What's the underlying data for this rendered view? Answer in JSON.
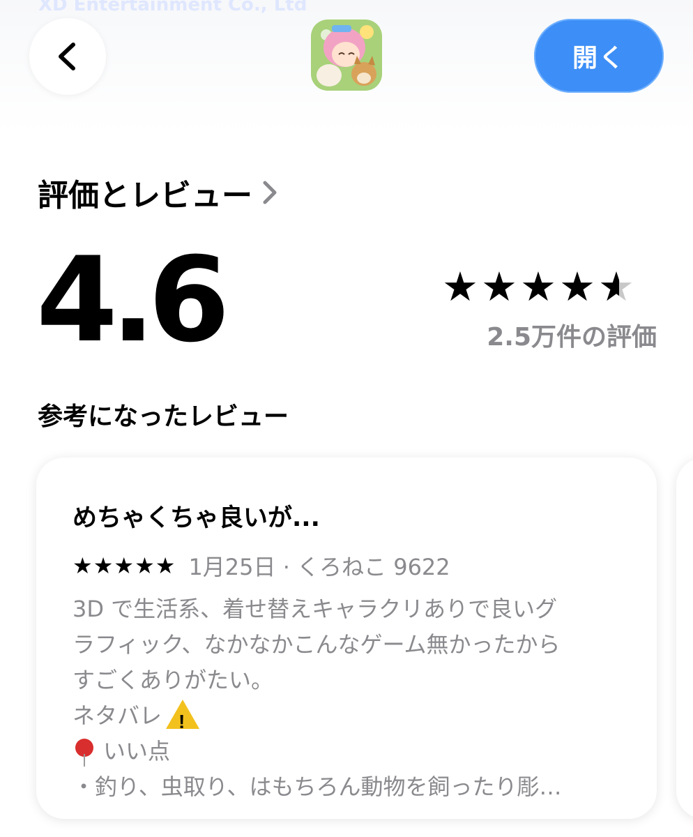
{
  "header": {
    "developer_faded": "XD Entertainment Co., Ltd",
    "open_label": "開く"
  },
  "ratings": {
    "section_title": "評価とレビュー",
    "score": "4.6",
    "stars_value": 4.6,
    "stars_max": 5,
    "count_label": "2.5万件の評価",
    "helpful_title": "参考になったレビュー"
  },
  "review": {
    "title": "めちゃくちゃ良いが...",
    "stars": "★★★★★",
    "meta": "1月25日 · くろねこ 9622",
    "lines": [
      "3D で生活系、着せ替えキャラクリありで良いグ",
      "ラフィック、なかなかこんなゲーム無かったから",
      "すごくありがたい。",
      "ネタバレ",
      "いい点",
      "・釣り、虫取り、はもちろん動物を飼ったり彫…"
    ]
  },
  "colors": {
    "accent": "#3d8ef6",
    "secondary_text": "#8a8a8e"
  }
}
